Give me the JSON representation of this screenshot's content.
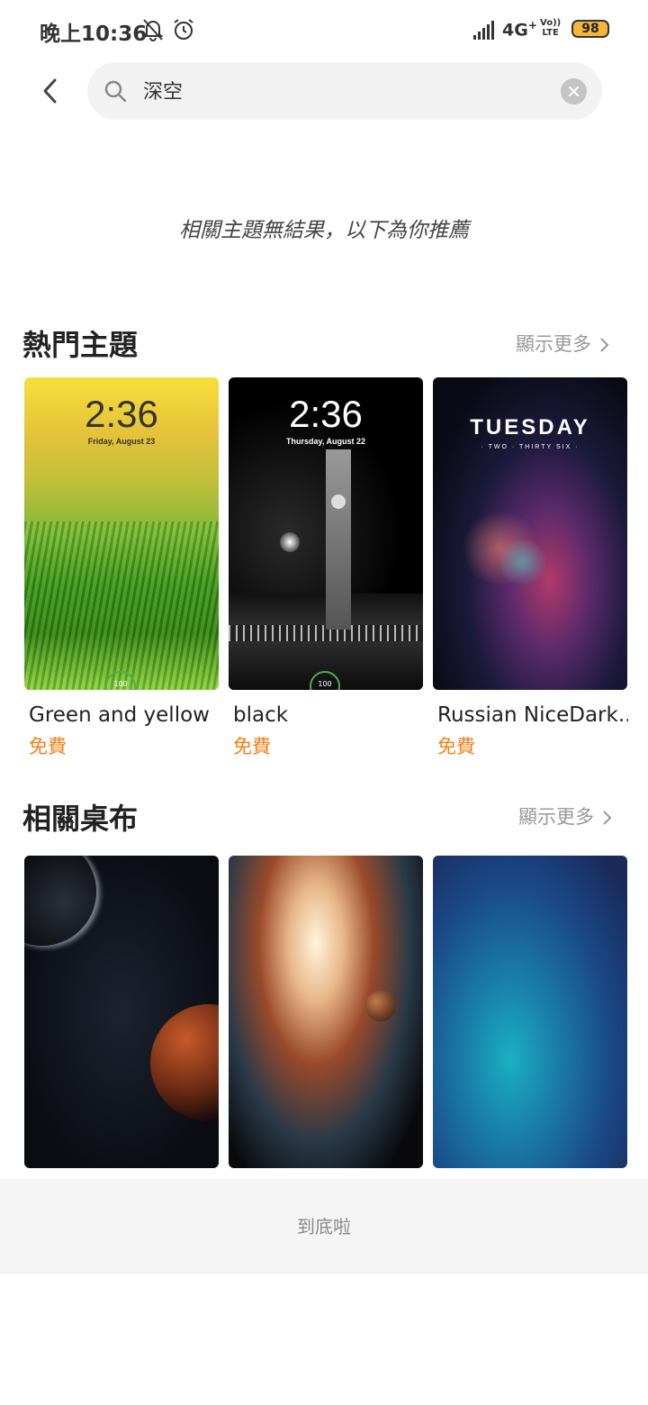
{
  "status_bar": {
    "time": "晚上10:36",
    "network": "4G",
    "network_plus": "+",
    "volte_top": "Vo))",
    "volte_bottom": "LTE",
    "battery": "98",
    "icons": [
      "bell-off-icon",
      "alarm-icon",
      "signal-icon"
    ]
  },
  "search": {
    "value": "深空",
    "icons": [
      "back-icon",
      "search-icon",
      "clear-icon"
    ]
  },
  "notice": "相關主題無結果，以下為你推薦",
  "hot_themes": {
    "title": "熱門主題",
    "more_label": "顯示更多",
    "items": [
      {
        "name": "Green and yellow",
        "price": "免費",
        "clock_time": "2:36",
        "clock_date": "Friday, August 23",
        "badge": "100"
      },
      {
        "name": "black",
        "price": "免費",
        "clock_time": "2:36",
        "clock_date": "Thursday, August 22",
        "badge": "100"
      },
      {
        "name": "Russian NiceDark...",
        "price": "免費",
        "clock_time": "TUESDAY",
        "clock_date": "· TWO · THIRTY SIX ·"
      }
    ]
  },
  "related_wallpapers": {
    "title": "相關桌布",
    "more_label": "顯示更多"
  },
  "footer": "到底啦",
  "colors": {
    "accent": "#f57f17",
    "battery": "#f4b63a",
    "search_bg": "#f2f2f2",
    "footer_bg": "#f5f5f5"
  }
}
